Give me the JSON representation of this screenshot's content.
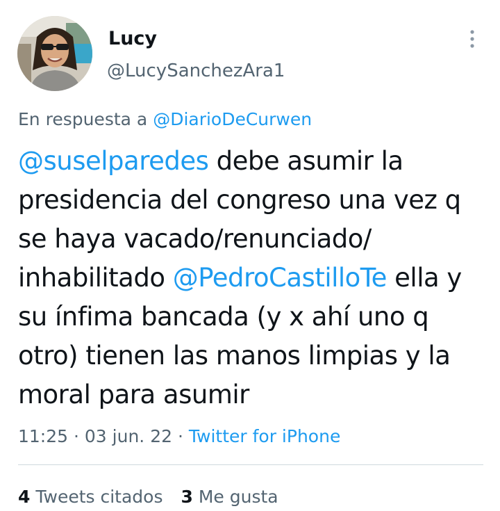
{
  "tweet": {
    "author": {
      "name": "Lucy",
      "handle": "@LucySanchezAra1"
    },
    "reply": {
      "prefix": "En respuesta a",
      "target": "@DiarioDeCurwen"
    },
    "text": {
      "mention1": "@suselparedes",
      "part1": " debe asumir la presidencia del congreso una vez q se haya vacado/renunciado/ inhabilitado ",
      "mention2": "@PedroCastilloTe",
      "part2": " ella y su ínfima bancada (y x ahí uno q otro) tienen las manos limpias y la moral para asumir"
    },
    "time": "11:25",
    "separator": "·",
    "date": "03 jun. 22",
    "source": "Twitter for iPhone"
  },
  "stats": {
    "quotes_count": "4",
    "quotes_label": "Tweets citados",
    "likes_count": "3",
    "likes_label": "Me gusta"
  },
  "icons": {
    "more": "more-vertical-icon",
    "avatar": "profile-photo"
  },
  "colors": {
    "link": "#1d9bf0",
    "secondary_text": "#536471",
    "primary_text": "#0f1419",
    "divider": "#cfd9de"
  }
}
